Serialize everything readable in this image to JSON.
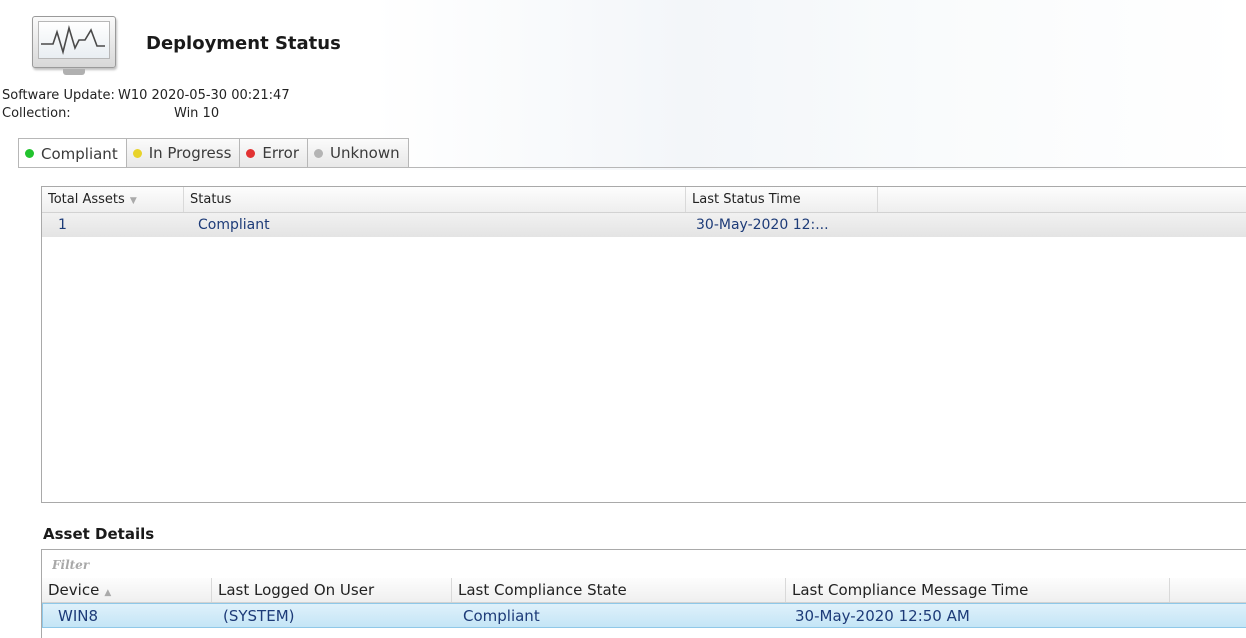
{
  "header": {
    "title": "Deployment Status",
    "icon": "monitor-heartbeat-icon"
  },
  "info": {
    "software_update_label": "Software Update:",
    "software_update_value": "W10 2020-05-30 00:21:47",
    "collection_label": "Collection:",
    "collection_value": "Win 10"
  },
  "tabs": [
    {
      "label": "Compliant",
      "dot_color": "#22c32e",
      "active": true
    },
    {
      "label": "In Progress",
      "dot_color": "#e8d32a",
      "active": false
    },
    {
      "label": "Error",
      "dot_color": "#e23232",
      "active": false
    },
    {
      "label": "Unknown",
      "dot_color": "#b4b4b4",
      "active": false
    }
  ],
  "summary": {
    "columns": [
      "Total Assets",
      "Status",
      "Last Status Time"
    ],
    "rows": [
      {
        "total_assets": "1",
        "status": "Compliant",
        "last_status_time": "30-May-2020 12:..."
      }
    ]
  },
  "asset_details": {
    "title": "Asset Details",
    "filter_placeholder": "Filter",
    "columns": [
      "Device",
      "Last Logged On User",
      "Last Compliance State",
      "Last Compliance Message Time"
    ],
    "rows": [
      {
        "device": "WIN8",
        "user": "(SYSTEM)",
        "state": "Compliant",
        "time": "30-May-2020 12:50 AM"
      }
    ]
  },
  "colors": {
    "selected_row": "#c9e8f8",
    "row_text": "#1d3b78"
  }
}
